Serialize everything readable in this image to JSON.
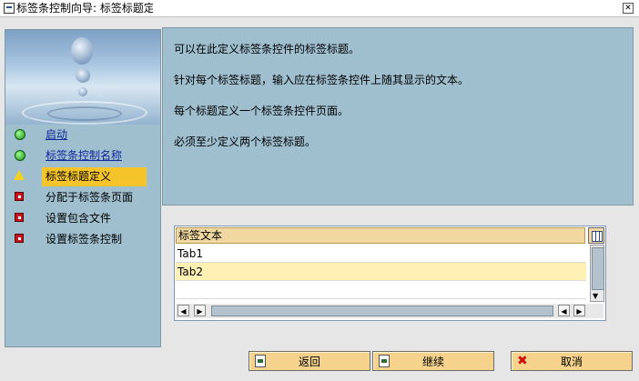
{
  "window": {
    "title": "标签条控制向导: 标签标题定义",
    "close_icon": "close-icon"
  },
  "steps": [
    {
      "label": "启动",
      "status": "done",
      "icon": "green-circle-icon"
    },
    {
      "label": "标签条控制名称",
      "status": "done",
      "icon": "green-circle-icon"
    },
    {
      "label": "标签标题定义",
      "status": "current",
      "icon": "warning-triangle-icon"
    },
    {
      "label": "分配于标签条页面",
      "status": "todo",
      "icon": "red-square-icon"
    },
    {
      "label": "设置包含文件",
      "status": "todo",
      "icon": "red-square-icon"
    },
    {
      "label": "设置标签条控制",
      "status": "todo",
      "icon": "red-square-icon"
    }
  ],
  "info": {
    "lines": [
      "可以在此定义标签条控件的标签标题。",
      "针对每个标签标题，输入应在标签条控件上随其显示的文本。",
      "每个标题定义一个标签条控件页面。",
      "必须至少定义两个标签标题。"
    ]
  },
  "table": {
    "header": "标签文本",
    "rows": [
      "Tab1",
      "Tab2",
      ""
    ],
    "selected_row": 1
  },
  "buttons": {
    "back": "返回",
    "continue": "继续",
    "cancel": "取消"
  },
  "colors": {
    "panel": "#9fbfcf",
    "highlight": "#f5c32a",
    "button": "#f5d38c",
    "link": "#10279c"
  }
}
